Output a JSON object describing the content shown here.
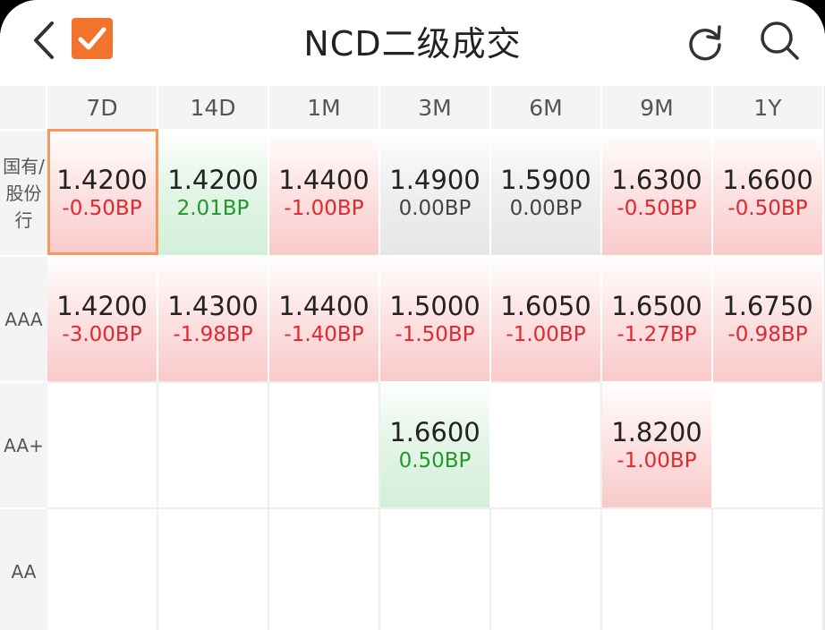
{
  "header": {
    "title": "NCD二级成交",
    "check_color": "#f3722c"
  },
  "columns": [
    "7D",
    "14D",
    "1M",
    "3M",
    "6M",
    "9M",
    "1Y"
  ],
  "rows": [
    {
      "label": "国有/股份行",
      "cells": [
        {
          "value": "1.4200",
          "change": "-0.50BP",
          "trend": "up",
          "selected": true
        },
        {
          "value": "1.4200",
          "change": "2.01BP",
          "trend": "down"
        },
        {
          "value": "1.4400",
          "change": "-1.00BP",
          "trend": "up"
        },
        {
          "value": "1.4900",
          "change": "0.00BP",
          "trend": "flat"
        },
        {
          "value": "1.5900",
          "change": "0.00BP",
          "trend": "flat"
        },
        {
          "value": "1.6300",
          "change": "-0.50BP",
          "trend": "up"
        },
        {
          "value": "1.6600",
          "change": "-0.50BP",
          "trend": "up"
        }
      ]
    },
    {
      "label": "AAA",
      "cells": [
        {
          "value": "1.4200",
          "change": "-3.00BP",
          "trend": "up"
        },
        {
          "value": "1.4300",
          "change": "-1.98BP",
          "trend": "up"
        },
        {
          "value": "1.4400",
          "change": "-1.40BP",
          "trend": "up"
        },
        {
          "value": "1.5000",
          "change": "-1.50BP",
          "trend": "up"
        },
        {
          "value": "1.6050",
          "change": "-1.00BP",
          "trend": "up"
        },
        {
          "value": "1.6500",
          "change": "-1.27BP",
          "trend": "up"
        },
        {
          "value": "1.6750",
          "change": "-0.98BP",
          "trend": "up"
        }
      ]
    },
    {
      "label": "AA+",
      "cells": [
        null,
        null,
        null,
        {
          "value": "1.6600",
          "change": "0.50BP",
          "trend": "down"
        },
        null,
        {
          "value": "1.8200",
          "change": "-1.00BP",
          "trend": "up"
        },
        null
      ]
    },
    {
      "label": "AA",
      "cells": [
        null,
        null,
        null,
        null,
        null,
        null,
        null
      ]
    }
  ],
  "colors": {
    "up_text": "#e0282e",
    "down_text": "#1d9a2a",
    "flat_text": "#444444",
    "up_bg": "#f9caca",
    "down_bg": "#d3efd8",
    "flat_bg": "#e6e6e6",
    "selected_border": "#f39a5c"
  }
}
